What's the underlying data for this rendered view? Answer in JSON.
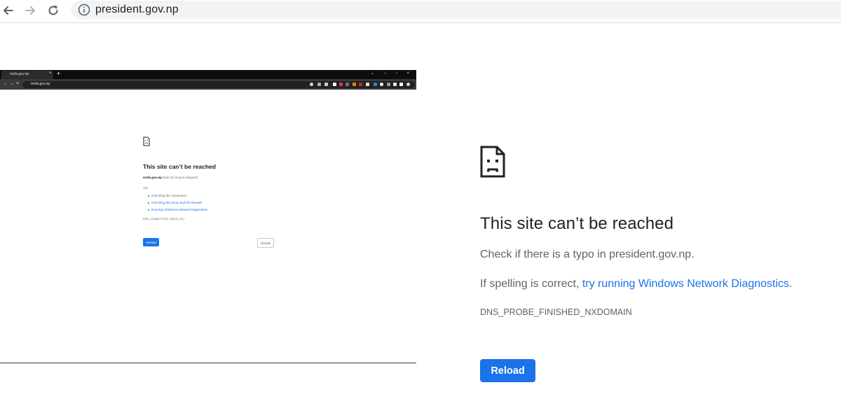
{
  "browser": {
    "url": "president.gov.np",
    "icons": {
      "back": "arrow-back-icon",
      "forward": "arrow-forward-icon",
      "reload": "reload-icon",
      "info": "info-circle-icon"
    }
  },
  "inset": {
    "tab_title": "mofa.gov.np",
    "tab_close": "×",
    "new_tab": "+",
    "window_controls": "⌄ – ▫ ×",
    "url": "mofa.gov.np",
    "page": {
      "title": "This site can’t be reached",
      "desc_domain": "mofa.gov.np",
      "desc_rest": " took too long to respond.",
      "try_label": "Try:",
      "suggestions": [
        {
          "text": "Checking the connection",
          "link": false
        },
        {
          "text": "Checking the proxy and the firewall",
          "link": true
        },
        {
          "text": "Running Windows Network Diagnostics",
          "link": true
        }
      ],
      "error_code": "ERR_CONNECTION_TIMED_OUT",
      "reload_label": "Reload",
      "details_label": "Details"
    }
  },
  "main": {
    "title": "This site can’t be reached",
    "line1": "Check if there is a typo in president.gov.np.",
    "line2_prefix": "If spelling is correct, ",
    "line2_link": "try running Windows Network Diagnostics",
    "line2_suffix": ".",
    "error_code": "DNS_PROBE_FINISHED_NXDOMAIN",
    "reload_label": "Reload",
    "icon": "sad-page-icon"
  },
  "colors": {
    "accent": "#1a73e8",
    "text": "#202124",
    "muted": "#5f6368",
    "omnibox": "#f1f3f4"
  }
}
